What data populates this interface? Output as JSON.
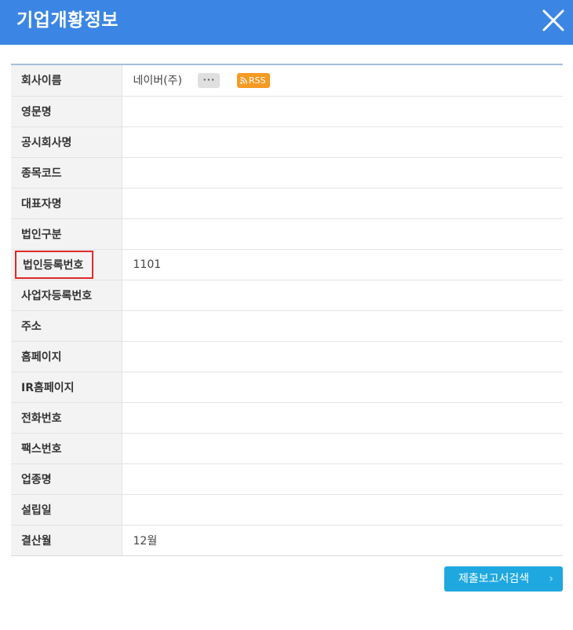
{
  "dialog": {
    "title": "기업개황정보",
    "close_icon": "close-icon"
  },
  "company": {
    "name_label": "회사이름",
    "name_value": "네이버(주)",
    "more_label": "···",
    "rss_label": "RSS"
  },
  "rows": [
    {
      "label": "영문명",
      "value": ""
    },
    {
      "label": "공시회사명",
      "value": ""
    },
    {
      "label": "종목코드",
      "value": ""
    },
    {
      "label": "대표자명",
      "value": ""
    },
    {
      "label": "법인구분",
      "value": ""
    },
    {
      "label": "법인등록번호",
      "value": "1101"
    },
    {
      "label": "사업자등록번호",
      "value": ""
    },
    {
      "label": "주소",
      "value": ""
    },
    {
      "label": "홈페이지",
      "value": ""
    },
    {
      "label": "IR홈페이지",
      "value": ""
    },
    {
      "label": "전화번호",
      "value": ""
    },
    {
      "label": "팩스번호",
      "value": ""
    },
    {
      "label": "업종명",
      "value": ""
    },
    {
      "label": "설립일",
      "value": ""
    },
    {
      "label": "결산월",
      "value": "12월"
    }
  ],
  "footer": {
    "search_button": "제출보고서검색",
    "search_chevron": "›"
  },
  "colors": {
    "header": "#3b86e4",
    "highlight_border": "#e02a2a",
    "rss": "#f59a23",
    "button": "#1fa8e0"
  }
}
